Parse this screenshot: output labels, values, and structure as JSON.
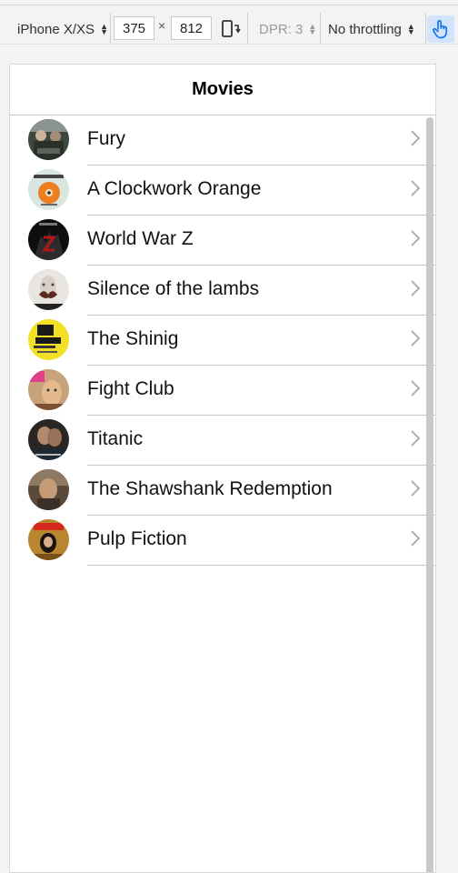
{
  "devtools": {
    "device": "iPhone X/XS",
    "width": "375",
    "times": "×",
    "height": "812",
    "dpr": "DPR: 3",
    "throttling": "No throttling"
  },
  "screen": {
    "title": "Movies"
  },
  "movies": [
    {
      "title": "Fury"
    },
    {
      "title": "A Clockwork Orange"
    },
    {
      "title": "World War Z"
    },
    {
      "title": "Silence of the lambs"
    },
    {
      "title": "The Shinig"
    },
    {
      "title": "Fight Club"
    },
    {
      "title": "Titanic"
    },
    {
      "title": "The Shawshank Redemption"
    },
    {
      "title": "Pulp Fiction"
    }
  ]
}
